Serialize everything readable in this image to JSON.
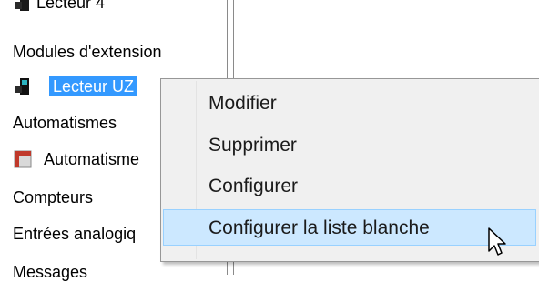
{
  "tree": {
    "items": [
      {
        "label": "Lecteur 4",
        "type": "reader-icon"
      },
      {
        "label": "Modules d'extension"
      },
      {
        "label": "Lecteur UZ",
        "type": "reader-icon",
        "selected": true
      },
      {
        "label": "Automatismes"
      },
      {
        "label": "Automatisme",
        "type": "automation-icon"
      },
      {
        "label": "Compteurs"
      },
      {
        "label": "Entrées analogiq"
      },
      {
        "label": "Messages"
      }
    ]
  },
  "context_menu": {
    "items": [
      {
        "label": "Modifier"
      },
      {
        "label": "Supprimer"
      },
      {
        "label": "Configurer"
      },
      {
        "label": "Configurer la liste blanche",
        "highlighted": true
      }
    ]
  },
  "colors": {
    "selection": "#3399ff",
    "menu_background": "#f0f0f0",
    "menu_highlight": "#cce8ff"
  }
}
